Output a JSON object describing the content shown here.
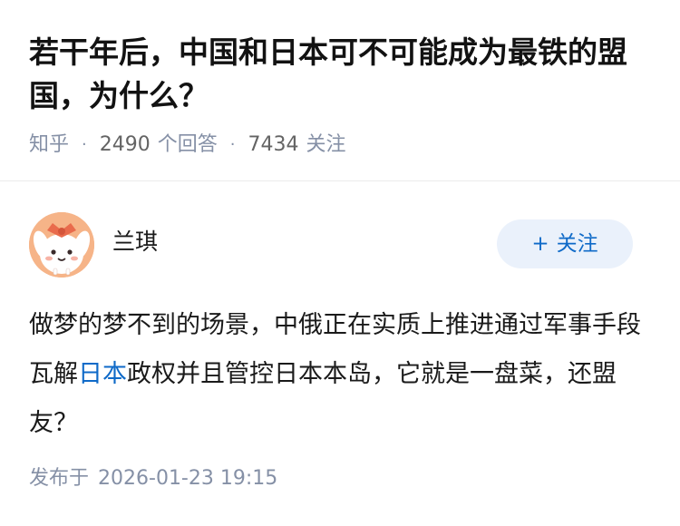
{
  "question": {
    "title": "若干年后，中国和日本可不可能成为最铁的盟国，为什么？",
    "source": "知乎",
    "separator": "·",
    "answer_count": "2490",
    "answer_label": "个回答",
    "follow_count": "7434",
    "follow_label": "关注"
  },
  "answer": {
    "author_name": "兰琪",
    "follow_button": {
      "plus": "+",
      "label": "关注"
    },
    "text_before": "做梦的梦不到的场景，中俄正在实质上推进通过军事手段瓦解",
    "link_text": "日本",
    "text_after": "政权并且管控日本本岛，它就是一盘菜，还盟友？",
    "publish_label": "发布于",
    "publish_time": "2026-01-23 19:15"
  },
  "colors": {
    "link": "#0f6ac8",
    "meta": "#8590a6",
    "follow_bg": "#eaf1fb",
    "avatar_bg": "#f6b488"
  },
  "icons": {
    "avatar": "cartoon-bunny-avatar"
  }
}
